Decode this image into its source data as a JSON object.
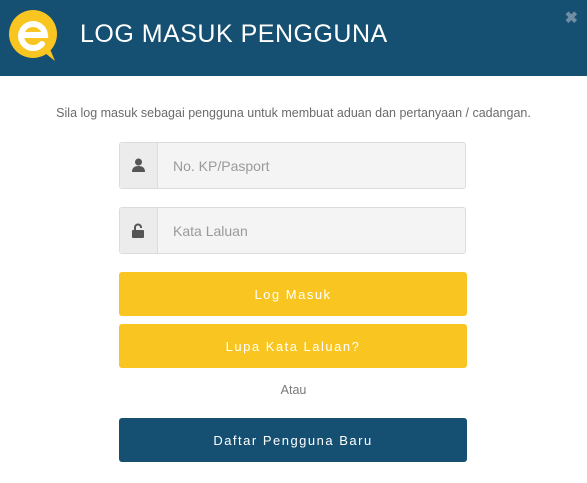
{
  "header": {
    "title": "LOG MASUK PENGGUNA",
    "close_symbol": "✖",
    "logo_icon": "e-logo-icon",
    "background_color": "#154f72"
  },
  "intro_text": "Sila log masuk sebagai pengguna untuk membuat aduan dan pertanyaan / cadangan.",
  "form": {
    "id_field": {
      "placeholder": "No. KP/Pasport",
      "value": "",
      "icon": "user-icon"
    },
    "password_field": {
      "placeholder": "Kata Laluan",
      "value": "",
      "icon": "unlock-icon"
    }
  },
  "buttons": {
    "login_label": "Log Masuk",
    "forgot_label": "Lupa Kata Laluan?",
    "or_label": "Atau",
    "register_label": "Daftar Pengguna Baru"
  },
  "colors": {
    "accent_yellow": "#f8c521",
    "primary_blue": "#154f72"
  }
}
